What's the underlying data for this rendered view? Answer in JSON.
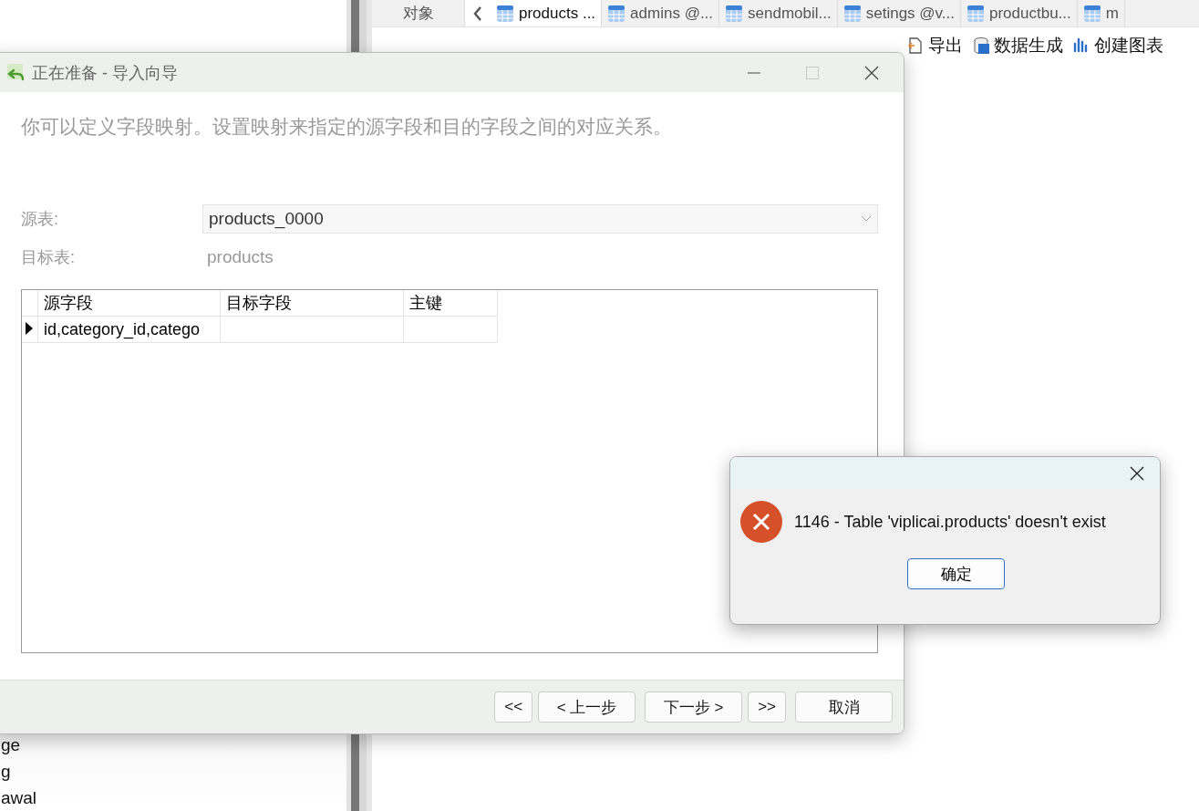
{
  "background": {
    "sidebar_items": [
      "ge",
      "g",
      "awal"
    ],
    "tabs": [
      {
        "label": "对象",
        "kind": "plain",
        "selected": false
      },
      {
        "label": "products ...",
        "kind": "table",
        "selected": true
      },
      {
        "label": "admins @...",
        "kind": "table",
        "selected": false
      },
      {
        "label": "sendmobil...",
        "kind": "table",
        "selected": false
      },
      {
        "label": "setings @v...",
        "kind": "table",
        "selected": false
      },
      {
        "label": "productbu...",
        "kind": "table",
        "selected": false
      },
      {
        "label": "m",
        "kind": "table",
        "selected": false
      }
    ],
    "toolbar": [
      {
        "label": "导出",
        "kind": "export",
        "disabled": false
      },
      {
        "label": "数据生成",
        "kind": "generate",
        "disabled": false
      },
      {
        "label": "创建图表",
        "kind": "chart",
        "disabled": false
      }
    ]
  },
  "wizard": {
    "title": "正在准备 - 导入向导",
    "description": "你可以定义字段映射。设置映射来指定的源字段和目的字段之间的对应关系。",
    "source_label": "源表:",
    "source_value": "products_0000",
    "target_label": "目标表:",
    "target_value": "products",
    "columns": [
      "源字段",
      "目标字段",
      "主键"
    ],
    "rows": [
      {
        "current": true,
        "cells": [
          "id,category_id,catego",
          "",
          ""
        ]
      }
    ],
    "buttons": [
      "<<",
      "< 上一步",
      "下一步 >",
      ">>",
      "取消"
    ]
  },
  "error_dialog": {
    "code_message": "1146 - Table 'viplicai.products' doesn't exist",
    "button": "确定"
  }
}
